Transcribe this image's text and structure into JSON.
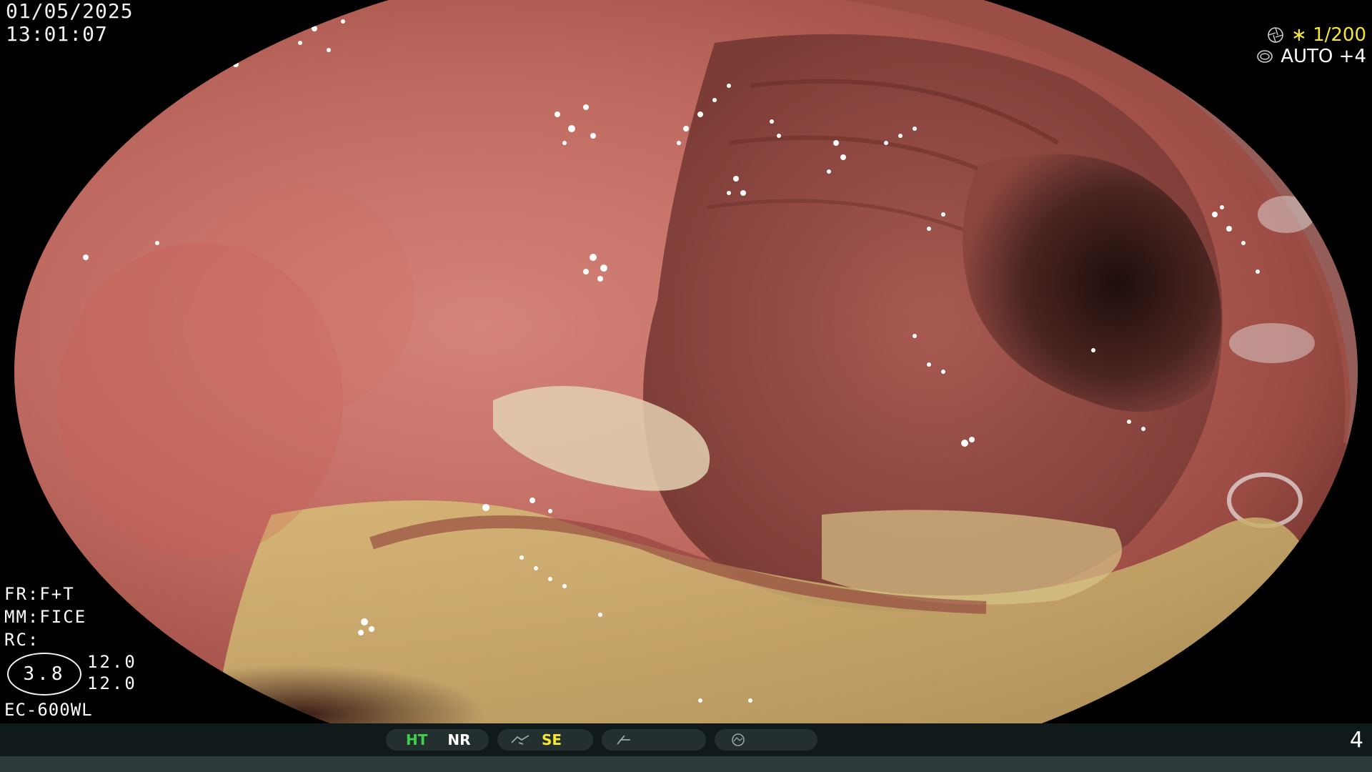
{
  "osd": {
    "date": "01/05/2025",
    "time": "13:01:07",
    "shutter": "∗ 1/200",
    "iris": "AUTO +4",
    "fr": "FR:F+T",
    "mm": "MM:FICE",
    "rc": "RC:",
    "gauge_value": "3.8",
    "value_a": "12.0",
    "value_b": "12.0",
    "scope_model": "EC-600WL"
  },
  "status_bar": {
    "ht": "HT",
    "nr": "NR",
    "se": "SE",
    "page_number": "4"
  },
  "colors": {
    "mucosa": "#b8645a",
    "lumen": "#2a1512",
    "ht_green": "#3fd14a",
    "se_yellow": "#f5e733"
  },
  "icons": {
    "shutter": "shutter-icon",
    "iris": "iris-icon",
    "structure": "structure-enhancement-icon",
    "color": "color-enhancement-icon",
    "mode": "mode-icon"
  }
}
